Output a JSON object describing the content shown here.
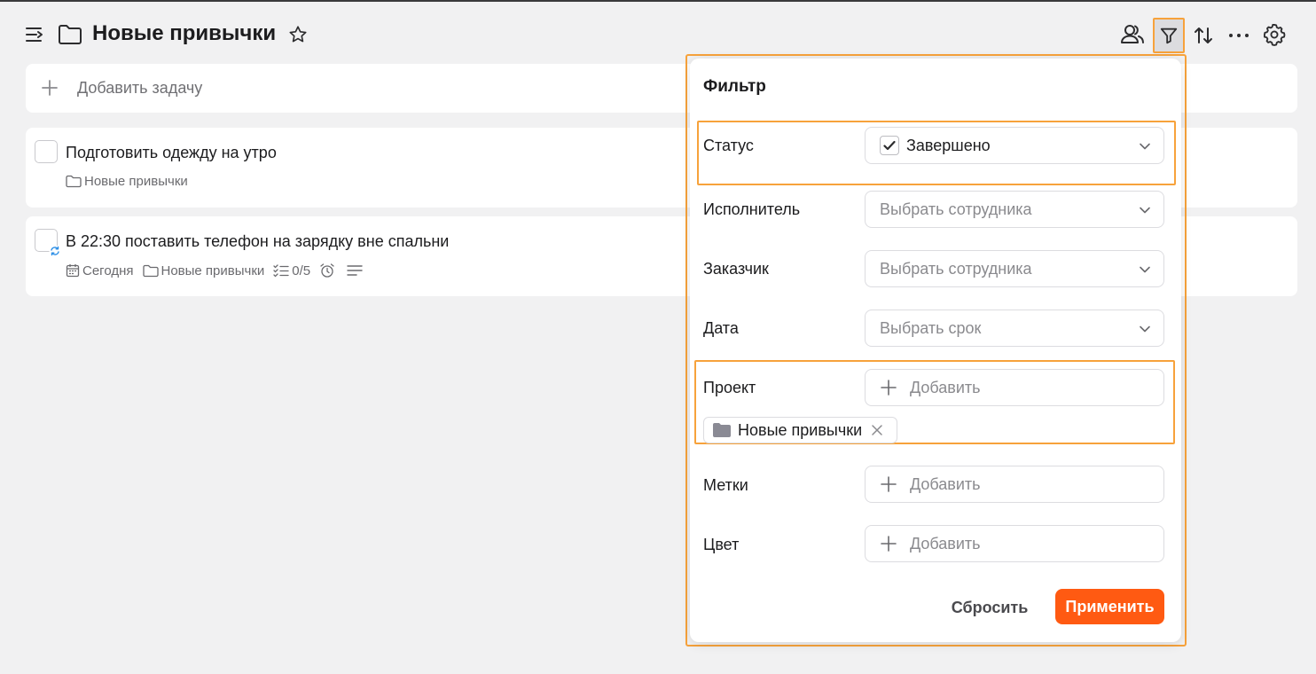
{
  "header": {
    "title": "Новые привычки"
  },
  "add_task": {
    "label": "Добавить задачу"
  },
  "tasks": [
    {
      "title": "Подготовить одежду на утро",
      "project": "Новые привычки"
    },
    {
      "title": "В 22:30 поставить телефон на зарядку вне спальни",
      "date": "Сегодня",
      "project": "Новые привычки",
      "checklist": "0/5"
    }
  ],
  "filter": {
    "title": "Фильтр",
    "status": {
      "label": "Статус",
      "value": "Завершено"
    },
    "assignee": {
      "label": "Исполнитель",
      "placeholder": "Выбрать сотрудника"
    },
    "customer": {
      "label": "Заказчик",
      "placeholder": "Выбрать сотрудника"
    },
    "date": {
      "label": "Дата",
      "placeholder": "Выбрать срок"
    },
    "project": {
      "label": "Проект",
      "add_label": "Добавить",
      "chip": "Новые привычки"
    },
    "tags": {
      "label": "Метки",
      "add_label": "Добавить"
    },
    "color": {
      "label": "Цвет",
      "add_label": "Добавить"
    },
    "reset_label": "Сбросить",
    "apply_label": "Применить"
  },
  "colors": {
    "accent": "#ff5a12",
    "highlight": "#f7a23b"
  }
}
